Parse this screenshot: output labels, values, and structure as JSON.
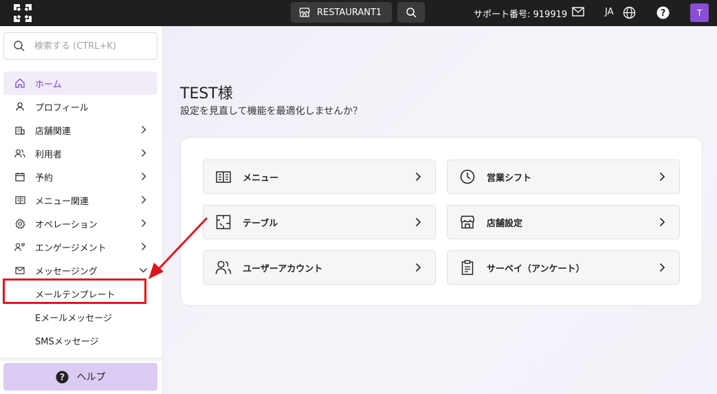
{
  "topbar": {
    "restaurant_label": "RESTAURANT1",
    "support_text": "サポート番号: 919919",
    "language": "JA",
    "avatar_initial": "T"
  },
  "sidebar": {
    "search_placeholder": "検索する (CTRL+K)",
    "items": [
      {
        "label": "ホーム",
        "icon": "home-icon",
        "active": true,
        "has_chevron": false
      },
      {
        "label": "プロフィール",
        "icon": "person-icon",
        "has_chevron": false
      },
      {
        "label": "店舗関連",
        "icon": "building-icon",
        "has_chevron": true
      },
      {
        "label": "利用者",
        "icon": "users-icon",
        "has_chevron": true
      },
      {
        "label": "予約",
        "icon": "calendar-icon",
        "has_chevron": true
      },
      {
        "label": "メニュー関連",
        "icon": "menu-book-icon",
        "has_chevron": true
      },
      {
        "label": "オペレーション",
        "icon": "gear-icon",
        "has_chevron": true
      },
      {
        "label": "エンゲージメント",
        "icon": "engagement-icon",
        "has_chevron": true
      },
      {
        "label": "メッセージング",
        "icon": "mail-icon",
        "has_chevron": true,
        "expanded": true
      }
    ],
    "sub_items": [
      "メールテンプレート",
      "Eメールメッセージ",
      "SMSメッセージ"
    ],
    "help_label": "ヘルプ"
  },
  "main": {
    "greeting": "TEST様",
    "subtitle": "設定を見直して機能を最適化しませんか？",
    "tiles": [
      {
        "label": "メニュー",
        "icon": "menu-book-icon"
      },
      {
        "label": "営業シフト",
        "icon": "clock-icon"
      },
      {
        "label": "テーブル",
        "icon": "table-layout-icon"
      },
      {
        "label": "店舗設定",
        "icon": "store-icon"
      },
      {
        "label": "ユーザーアカウント",
        "icon": "users-icon"
      },
      {
        "label": "サーベイ（アンケート）",
        "icon": "clipboard-icon"
      }
    ]
  },
  "colors": {
    "accent": "#7b3fd1",
    "annotation": "#e0141e",
    "topbar": "#1f1f1f"
  }
}
